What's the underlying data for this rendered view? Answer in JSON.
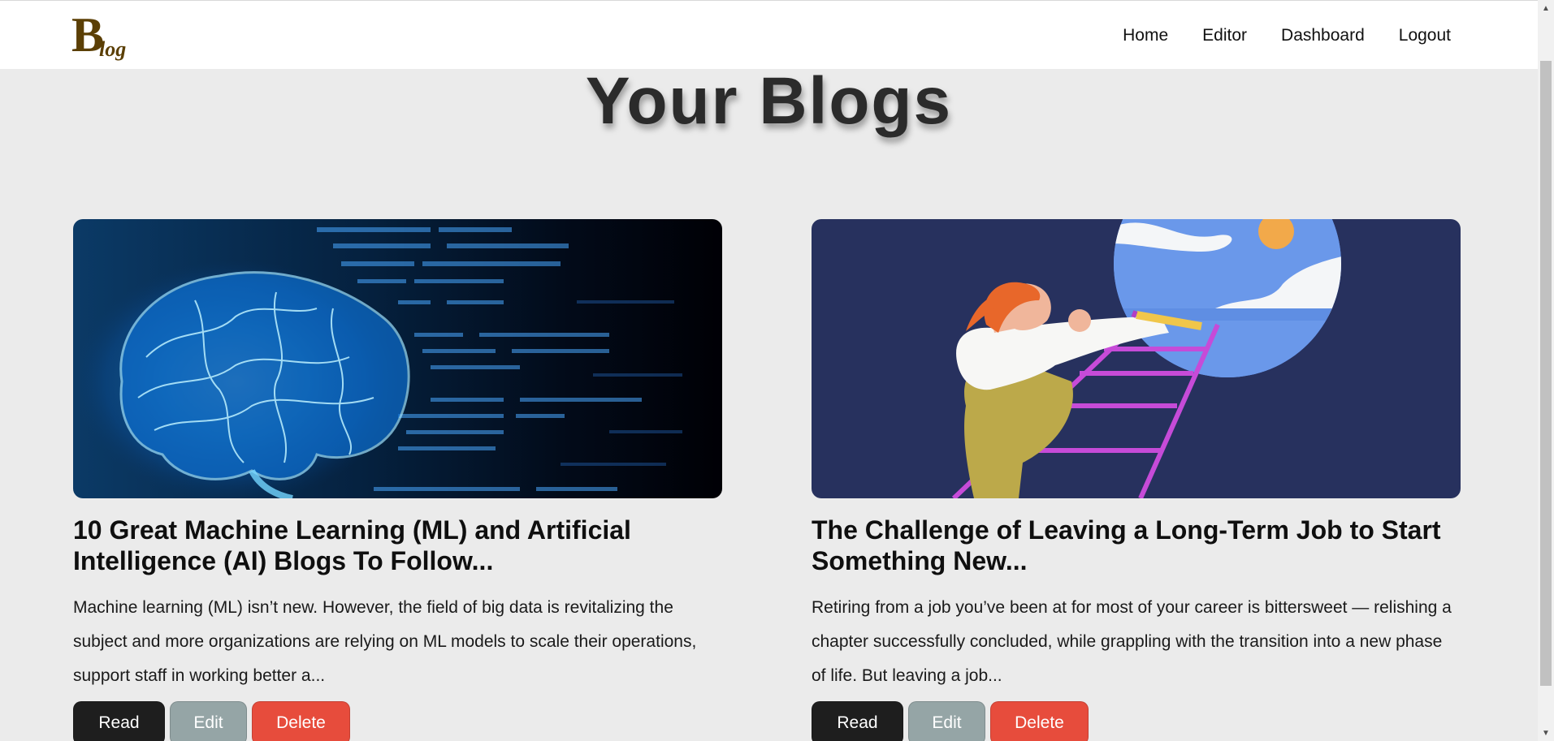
{
  "nav": {
    "logo_big": "B",
    "logo_small": "log",
    "links": [
      "Home",
      "Editor",
      "Dashboard",
      "Logout"
    ]
  },
  "page": {
    "title": "Your Blogs"
  },
  "blogs": [
    {
      "image": "machine-learning-brain-image",
      "title": "10 Great Machine Learning (ML) and Artificial Intelligence (AI) Blogs To Follow...",
      "excerpt": "Machine learning (ML) isn’t new. However, the field of big data is revitalizing the subject and more organizations are relying on ML models to scale their operations, support staff in working better a...",
      "buttons": {
        "read": "Read",
        "edit": "Edit",
        "delete": "Delete"
      }
    },
    {
      "image": "woman-climbing-ladder-illustration",
      "title": "The Challenge of Leaving a Long-Term Job to Start Something New...",
      "excerpt": "Retiring from a job you’ve been at for most of your career is bittersweet — relishing a chapter successfully concluded, while grappling with the transition into a new phase of life. But leaving a job...",
      "buttons": {
        "read": "Read",
        "edit": "Edit",
        "delete": "Delete"
      }
    }
  ],
  "colors": {
    "page_bg": "#ebebeb",
    "logo": "#5b3f05",
    "read": "#1e1e1e",
    "edit": "#95a5a6",
    "delete": "#e74c3c"
  }
}
